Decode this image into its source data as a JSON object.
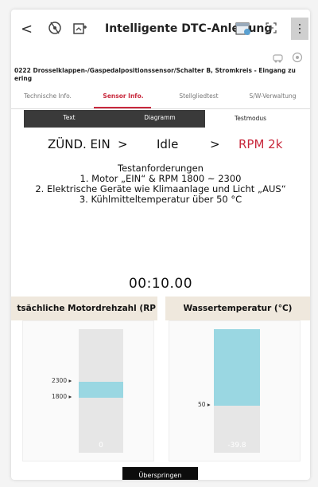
{
  "header": {
    "back_label": "<",
    "title": "Intelligente DTC-Anleitung",
    "menu_label": "⋮"
  },
  "dtc_description": "0222 Drosselklappen-/Gaspedalpositionssensor/Schalter B, Stromkreis - Eingang zu ering",
  "tabs": [
    {
      "label": "Technische Info."
    },
    {
      "label": "Sensor Info."
    },
    {
      "label": "Stellgliedtest"
    },
    {
      "label": "S/W-Verwaltung"
    }
  ],
  "modes": [
    {
      "label": "Text"
    },
    {
      "label": "Diagramm"
    },
    {
      "label": "Testmodus"
    }
  ],
  "steps": {
    "step1": "ZÜND. EIN",
    "arrow1": ">",
    "step2": "Idle",
    "arrow2": ">",
    "step3": "RPM 2k"
  },
  "requirements": {
    "title": "Testanforderungen",
    "line1": "1. Motor „EIN“ & RPM 1800 ~ 2300",
    "line2": "2. Elektrische Geräte wie Klimaanlage und Licht „AUS“",
    "line3": "3. Kühlmitteltemperatur über 50 °C"
  },
  "timer": "00:10.00",
  "gauges": {
    "rpm": {
      "label": "tsächliche Motordrehzahl (RP",
      "value": "0",
      "tick_high": "2300 ▸",
      "tick_low": "1800 ▸",
      "range_high": 2300,
      "range_low": 1800
    },
    "coolant": {
      "label": "Wassertemperatur (°C)",
      "value": "-39.8",
      "tick": "50 ▸",
      "threshold": 50
    }
  },
  "skip_button": "Überspringen",
  "colors": {
    "accent": "#c8283c",
    "fill": "#9ad7e2",
    "dark": "#3a3a3a"
  }
}
